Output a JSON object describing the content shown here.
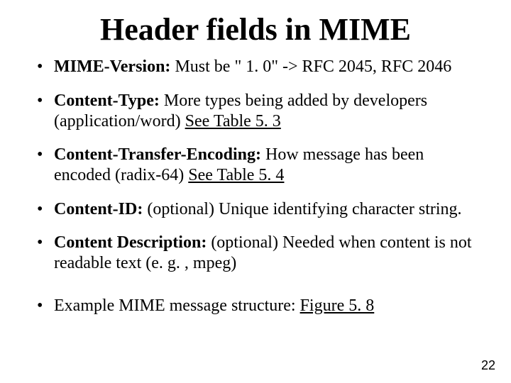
{
  "title": "Header fields in MIME",
  "bullets": [
    {
      "lead": "MIME-Version:",
      "rest": " Must be \" 1. 0\" -> RFC 2045, RFC 2046",
      "underline": ""
    },
    {
      "lead": "Content-Type:",
      "rest": " More types being added by developers (application/word) ",
      "underline": "See Table 5. 3"
    },
    {
      "lead": "Content-Transfer-Encoding:",
      "rest": " How message has been encoded (radix-64) ",
      "underline": "See Table 5. 4"
    },
    {
      "lead": "Content-ID:",
      "rest": " (optional) Unique identifying character string.",
      "underline": ""
    },
    {
      "lead": "Content Description:",
      "rest": " (optional) Needed when content is not readable text (e. g. , mpeg)",
      "underline": ""
    },
    {
      "lead": "",
      "rest": "Example MIME message structure: ",
      "underline": "Figure 5. 8"
    }
  ],
  "page_number": "22"
}
